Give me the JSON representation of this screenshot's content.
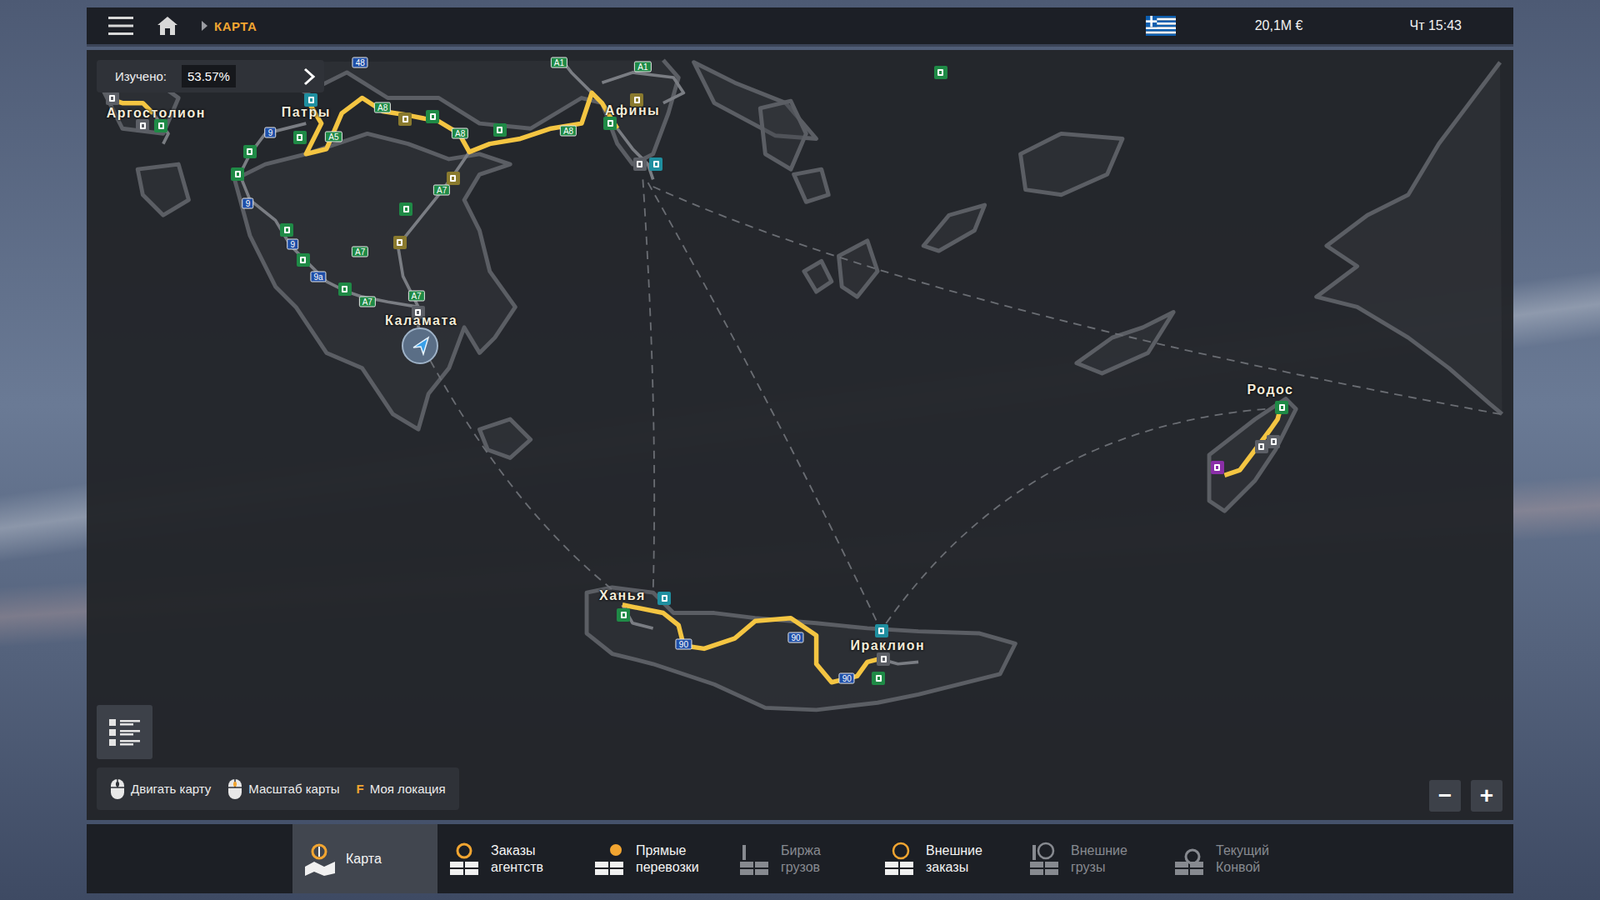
{
  "top_bar": {
    "breadcrumb": "КАРТА",
    "money": "20,1M €",
    "time": "Чт 15:43"
  },
  "explored": {
    "label": "Изучено:",
    "value": "53.57%"
  },
  "map": {
    "cities": [
      {
        "name": "Аргостолион"
      },
      {
        "name": "Патры"
      },
      {
        "name": "Афины"
      },
      {
        "name": "Каламата"
      },
      {
        "name": "Ханья"
      },
      {
        "name": "Ираклион"
      },
      {
        "name": "Родос"
      }
    ],
    "road_signs": [
      {
        "label": "A1",
        "color": "#1f8a46"
      },
      {
        "label": "A1",
        "color": "#1f8a46"
      },
      {
        "label": "48",
        "color": "#1f4fa8"
      },
      {
        "label": "A8",
        "color": "#1f8a46"
      },
      {
        "label": "A8",
        "color": "#1f8a46"
      },
      {
        "label": "A8",
        "color": "#1f8a46"
      },
      {
        "label": "A5",
        "color": "#1f8a46"
      },
      {
        "label": "9",
        "color": "#1f4fa8"
      },
      {
        "label": "9",
        "color": "#1f4fa8"
      },
      {
        "label": "9",
        "color": "#1f4fa8"
      },
      {
        "label": "9a",
        "color": "#1f4fa8"
      },
      {
        "label": "A7",
        "color": "#1f8a46"
      },
      {
        "label": "A7",
        "color": "#1f8a46"
      },
      {
        "label": "A7",
        "color": "#1f8a46"
      },
      {
        "label": "A7",
        "color": "#1f8a46"
      },
      {
        "label": "90",
        "color": "#1f4fa8"
      },
      {
        "label": "90",
        "color": "#1f4fa8"
      },
      {
        "label": "90",
        "color": "#1f4fa8"
      }
    ]
  },
  "controls": {
    "hints": [
      {
        "kind": "mouse-drag",
        "key": "",
        "label": "Двигать карту"
      },
      {
        "kind": "mouse-wheel",
        "key": "",
        "label": "Масштаб карты"
      },
      {
        "kind": "key",
        "key": "F",
        "label": "Моя локация"
      }
    ],
    "zoom": [
      "−",
      "+"
    ]
  },
  "nav_tabs": [
    {
      "lines": [
        "Карта"
      ],
      "selected": true,
      "disabled": false
    },
    {
      "lines": [
        "Заказы",
        "агентств"
      ],
      "selected": false,
      "disabled": false
    },
    {
      "lines": [
        "Прямые",
        "перевозки"
      ],
      "selected": false,
      "disabled": false
    },
    {
      "lines": [
        "Биржа",
        "грузов"
      ],
      "selected": false,
      "disabled": true
    },
    {
      "lines": [
        "Внешние",
        "заказы"
      ],
      "selected": false,
      "disabled": false
    },
    {
      "lines": [
        "Внешние",
        "грузы"
      ],
      "selected": false,
      "disabled": true
    },
    {
      "lines": [
        "Текущий",
        "Конвой"
      ],
      "selected": false,
      "disabled": true
    }
  ]
}
